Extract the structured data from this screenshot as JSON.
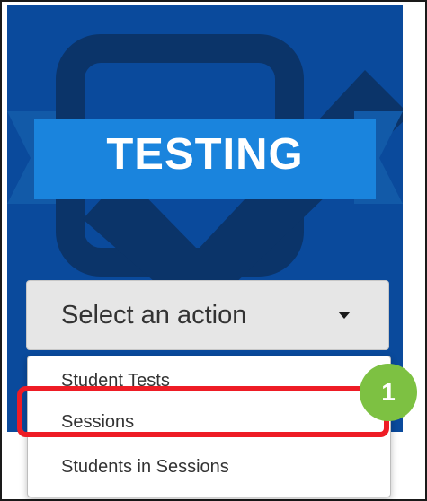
{
  "tile": {
    "title": "TESTING",
    "icon": "checkbox-check-icon",
    "colors": {
      "background": "#0a4a9c",
      "ribbon": "#1a84dd",
      "icon_shadow": "#0b3469"
    }
  },
  "action_select": {
    "selected_label": "Select an action",
    "icon": "caret-down-icon"
  },
  "action_menu": {
    "items": [
      {
        "label": "Student Tests"
      },
      {
        "label": "Sessions"
      },
      {
        "label": "Students in Sessions"
      }
    ],
    "highlighted_index": 1
  },
  "annotation": {
    "step_number": "1",
    "highlight_color": "#ee1c25",
    "badge_color": "#7dc142"
  }
}
